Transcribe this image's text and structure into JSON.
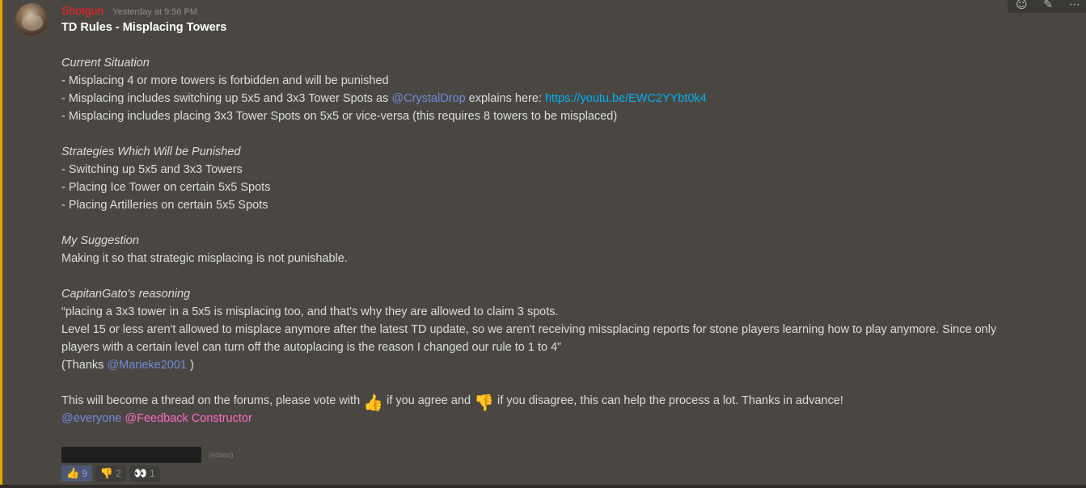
{
  "message": {
    "username": "Shotgun",
    "timestamp": "Yesterday at 9:56 PM",
    "title": "TD Rules - Misplacing Towers",
    "current_heading": "Current Situation",
    "current_1": "- Misplacing 4 or more towers is forbidden and will be punished",
    "current_2_a": "- Misplacing includes switching up 5x5 and 3x3 Tower Spots as ",
    "current_2_mention": "@CrystalDrop",
    "current_2_b": " explains here: ",
    "current_2_link": "https://youtu.be/EWC2YYbt0k4",
    "current_3": "- Misplacing includes placing 3x3 Tower Spots on 5x5 or vice-versa (this requires 8 towers to be misplaced)",
    "strategies_heading": "Strategies Which Will be Punished",
    "strategies_1": "- Switching up 5x5 and 3x3 Towers",
    "strategies_2": "- Placing Ice Tower on certain 5x5 Spots",
    "strategies_3": "- Placing Artilleries on certain 5x5 Spots",
    "suggestion_heading": "My Suggestion",
    "suggestion_text": "Making it so that strategic misplacing is not punishable.",
    "reasoning_heading": "CapitanGato's reasoning",
    "reasoning_1": "“placing a 3x3 tower in a 5x5 is misplacing too, and that's why they are allowed to claim 3 spots.",
    "reasoning_2": "Level 15 or less aren't allowed to misplace anymore after the latest TD update, so we aren't receiving missplacing reports for stone players learning how to play anymore. Since only",
    "reasoning_3": "players with a certain level can turn off the autoplacing is the reason I changed our rule to 1 to 4”",
    "thanks_a": "(Thanks ",
    "thanks_mention": "@Marieke2001",
    "thanks_b": " )",
    "vote_a": "This will become a thread on the forums, please vote with ",
    "vote_b": " if you agree and ",
    "vote_c": " if you disagree, this can help the process a lot. Thanks in advance!",
    "mention_everyone": "@everyone",
    "mention_role": "@Feedback Constructor",
    "edited": "(edited)"
  },
  "emoji": {
    "thumbs_up": "👍",
    "thumbs_down": "👎",
    "eyes": "👀"
  },
  "reactions": [
    {
      "emoji": "👍",
      "count": "9",
      "icon": "thumbs-up-icon"
    },
    {
      "emoji": "👎",
      "count": "2",
      "icon": "thumbs-down-icon"
    },
    {
      "emoji": "👀",
      "count": "1",
      "icon": "eyes-icon"
    }
  ],
  "toolbar": {
    "react_icon": "☺",
    "edit_icon": "✎",
    "more_icon": "⋯"
  },
  "colors": {
    "accent_border": "#e8a400",
    "username": "#ff2020",
    "mention": "#7289da",
    "role_mention": "#ff69c8",
    "link": "#00b0f4"
  }
}
